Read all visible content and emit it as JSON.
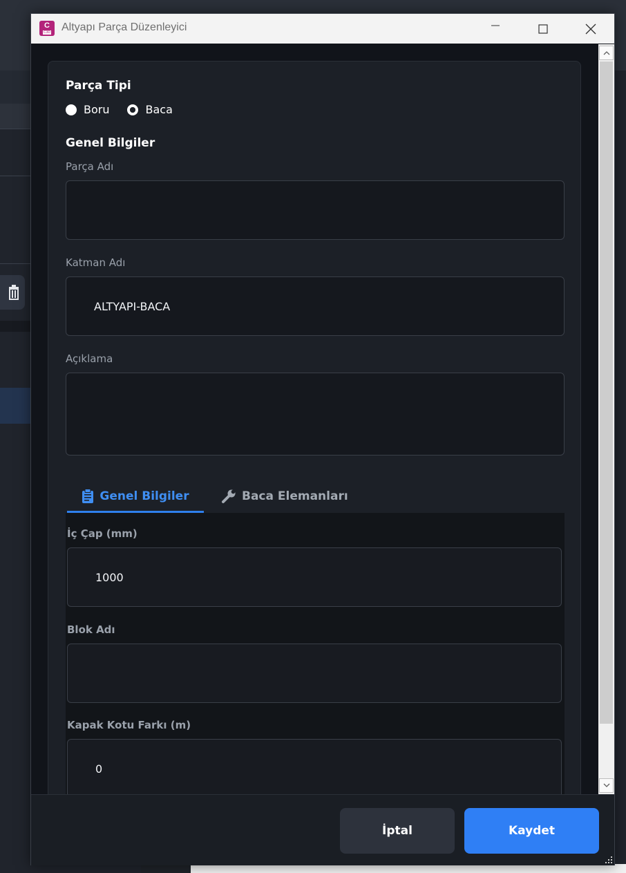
{
  "window": {
    "title": "Altyapı Parça Düzenleyici",
    "app_icon_letter": "C",
    "app_icon_badge": "C3D"
  },
  "part_type": {
    "heading": "Parça Tipi",
    "options": [
      {
        "label": "Boru",
        "selected": false
      },
      {
        "label": "Baca",
        "selected": true
      }
    ]
  },
  "general": {
    "heading": "Genel Bilgiler",
    "part_name_label": "Parça Adı",
    "part_name_value": "",
    "layer_name_label": "Katman Adı",
    "layer_name_value": "ALTYAPI-BACA",
    "description_label": "Açıklama",
    "description_value": ""
  },
  "tabs": [
    {
      "label": "Genel Bilgiler",
      "icon": "clipboard-icon",
      "active": true
    },
    {
      "label": "Baca Elemanları",
      "icon": "wrench-icon",
      "active": false
    }
  ],
  "tab_general": {
    "inner_diameter_label": "İç Çap (mm)",
    "inner_diameter_value": "1000",
    "block_name_label": "Blok Adı",
    "block_name_value": "",
    "cover_elevation_label": "Kapak Kotu Farkı (m)",
    "cover_elevation_value": "0"
  },
  "footer": {
    "cancel_label": "İptal",
    "save_label": "Kaydet"
  },
  "colors": {
    "accent": "#2f7ff5",
    "app_icon": "#b3247a",
    "background": "#11141a"
  },
  "background_app": {
    "trash_icon": "trash-icon"
  }
}
